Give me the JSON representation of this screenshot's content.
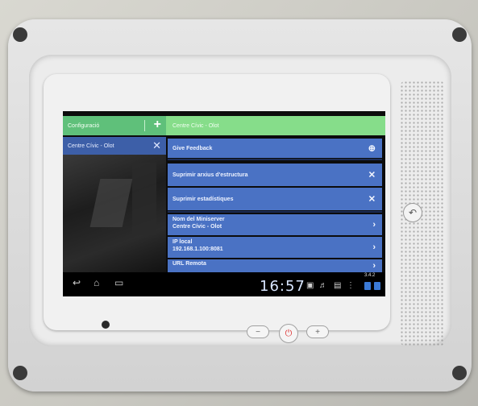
{
  "left_pane": {
    "header_title": "Configuració",
    "add_icon": "plus-icon",
    "item_label": "Centre Cívic - Olot",
    "close_icon": "close-icon"
  },
  "right_pane": {
    "header_title": "Centre Cívic - Olot",
    "rows": [
      {
        "title": "Give Feedback",
        "subtitle": "",
        "icon": "feedback-icon"
      },
      {
        "title": "Suprimir arxius d'estructura",
        "subtitle": "",
        "icon": "close-icon"
      },
      {
        "title": "Suprimir estadístiques",
        "subtitle": "",
        "icon": "close-icon"
      },
      {
        "title": "Nom del Miniserver",
        "subtitle": "Centre Cívic - Olot",
        "icon": "chevron-right-icon"
      },
      {
        "title": "IP local",
        "subtitle": "192.168.1.100:8081",
        "icon": "chevron-right-icon"
      },
      {
        "title": "URL Remota",
        "subtitle": "",
        "icon": "chevron-right-icon"
      }
    ]
  },
  "status_bar": {
    "time": "16:57",
    "notification_number": "3.4.2"
  },
  "colors": {
    "header_green": "#5fc07a",
    "header_green_light": "#86dd8a",
    "row_blue": "#4a72c4",
    "item_blue": "#3d5fa8"
  }
}
